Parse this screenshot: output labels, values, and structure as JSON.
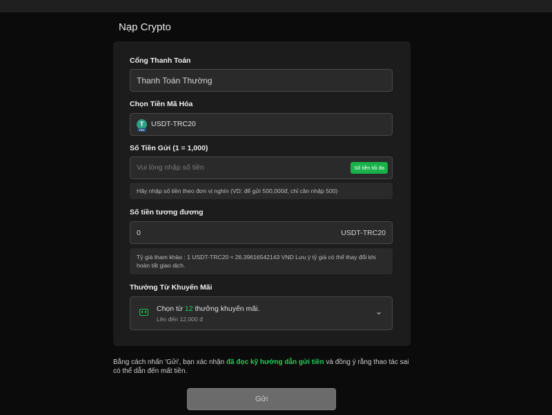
{
  "page": {
    "title": "Nạp Crypto"
  },
  "form": {
    "gateway": {
      "label": "Cổng Thanh Toán",
      "value": "Thanh Toán Thường"
    },
    "coin": {
      "label": "Chọn Tiền Mã Hóa",
      "value": "USDT-TRC20",
      "icon_glyph": "T",
      "icon_badge": "TRC"
    },
    "amount": {
      "label": "Số Tiền Gửi (1 = 1,000)",
      "placeholder": "Vui lòng nhập số tiền",
      "max_label": "Số tiền tối đa",
      "hint": "Hãy nhập số tiền theo đơn vị nghìn (VD: để gửi 500,000đ, chỉ cần nhập 500)"
    },
    "equivalent": {
      "label": "Số tiền tương đương",
      "value": "0",
      "currency": "USDT-TRC20",
      "rate_note": "Tỷ giá tham khảo : 1 USDT-TRC20 ≈ 26.39616542143 VND Lưu ý tỷ giá có thể thay đổi khi hoàn tất giao dịch."
    },
    "promo": {
      "label": "Thưởng Từ Khuyến Mãi",
      "text_before": "Chọn từ ",
      "count": "12",
      "text_after": " thưởng khuyến mãi.",
      "sub": "Lên đến 12,000 đ",
      "icon": "ticket-icon"
    }
  },
  "consent": {
    "before": "Bằng cách nhấn 'Gửi', bạn xác nhận ",
    "link": "đã đọc kỹ hướng dẫn gửi tiền",
    "after": " và đồng ý rằng thao tác sai có thể dẫn đến mất tiền."
  },
  "submit_label": "Gửi",
  "colors": {
    "accent": "#21d15a",
    "panel": "#1c1c1c",
    "field": "#2a2a2a",
    "background": "#0b0b0b"
  }
}
